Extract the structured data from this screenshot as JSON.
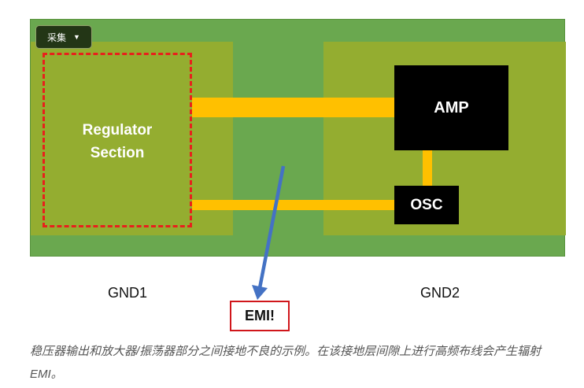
{
  "toolbar": {
    "collect_label": "采集"
  },
  "diagram": {
    "regulator_label": "Regulator\nSection",
    "amp_label": "AMP",
    "osc_label": "OSC",
    "gnd1_label": "GND1",
    "gnd2_label": "GND2",
    "emi_label": "EMI!"
  },
  "caption": "稳压器输出和放大器/振荡器部分之间接地不良的示例。在该接地层间隙上进行高频布线会产生辐射 EMI。",
  "colors": {
    "board_green": "#6aa84f",
    "ground_plane": "#94ad30",
    "trace": "#ffc000",
    "outline_red": "#e8201c",
    "arrow_blue": "#4472c4"
  },
  "icons": {
    "dropdown": "caret-down-icon"
  }
}
